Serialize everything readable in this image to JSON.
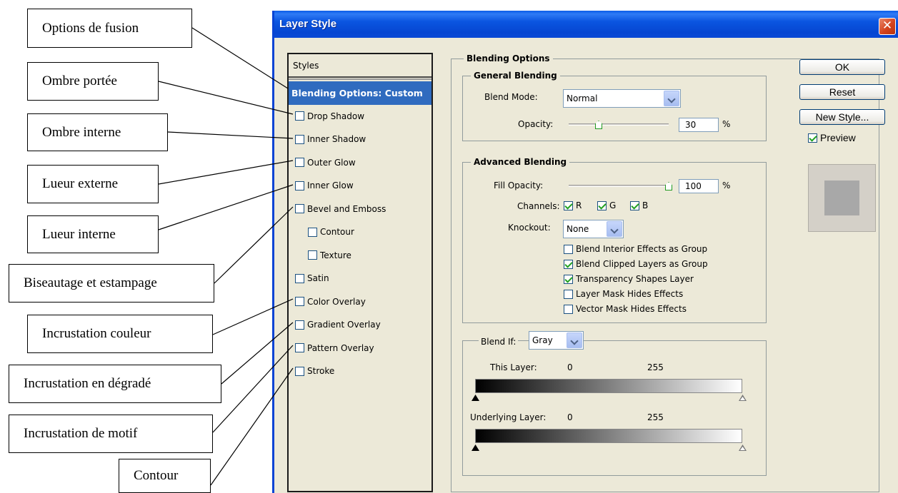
{
  "annotations": [
    "Options de fusion",
    "Ombre portée",
    "Ombre interne",
    "Lueur externe",
    "Lueur interne",
    "Biseautage et estampage",
    "Incrustation couleur",
    "Incrustation en dégradé",
    "Incrustation de motif",
    "Contour"
  ],
  "dialog": {
    "title": "Layer Style",
    "close_glyph": "✕"
  },
  "styles_panel": {
    "header": "Styles",
    "selected": "Blending Options: Custom",
    "items": [
      {
        "label": "Drop Shadow",
        "checked": false
      },
      {
        "label": "Inner Shadow",
        "checked": false
      },
      {
        "label": "Outer Glow",
        "checked": false
      },
      {
        "label": "Inner Glow",
        "checked": false
      },
      {
        "label": "Bevel and Emboss",
        "checked": false
      },
      {
        "label": "Contour",
        "checked": false
      },
      {
        "label": "Texture",
        "checked": false
      },
      {
        "label": "Satin",
        "checked": false
      },
      {
        "label": "Color Overlay",
        "checked": false
      },
      {
        "label": "Gradient Overlay",
        "checked": false
      },
      {
        "label": "Pattern Overlay",
        "checked": false
      },
      {
        "label": "Stroke",
        "checked": false
      }
    ]
  },
  "blending": {
    "title": "Blending Options",
    "general": {
      "title": "General Blending",
      "blend_mode_label": "Blend Mode:",
      "blend_mode_value": "Normal",
      "opacity_label": "Opacity:",
      "opacity_value": "30",
      "opacity_unit": "%",
      "opacity_fraction": 0.3
    },
    "advanced": {
      "title": "Advanced Blending",
      "fill_label": "Fill Opacity:",
      "fill_value": "100",
      "fill_unit": "%",
      "fill_fraction": 1.0,
      "channels_label": "Channels:",
      "channels": [
        {
          "label": "R",
          "checked": true
        },
        {
          "label": "G",
          "checked": true
        },
        {
          "label": "B",
          "checked": true
        }
      ],
      "knockout_label": "Knockout:",
      "knockout_value": "None",
      "options": [
        {
          "label": "Blend Interior Effects as Group",
          "checked": false
        },
        {
          "label": "Blend Clipped Layers as Group",
          "checked": true
        },
        {
          "label": "Transparency Shapes Layer",
          "checked": true
        },
        {
          "label": "Layer Mask Hides Effects",
          "checked": false
        },
        {
          "label": "Vector Mask Hides Effects",
          "checked": false
        }
      ]
    },
    "blend_if": {
      "label": "Blend If:",
      "value": "Gray",
      "this_layer_label": "This Layer:",
      "this_layer_min": "0",
      "this_layer_max": "255",
      "underlying_label": "Underlying Layer:",
      "underlying_min": "0",
      "underlying_max": "255"
    }
  },
  "buttons": {
    "ok": "OK",
    "reset": "Reset",
    "new_style": "New Style...",
    "preview_label": "Preview",
    "preview_checked": true
  }
}
